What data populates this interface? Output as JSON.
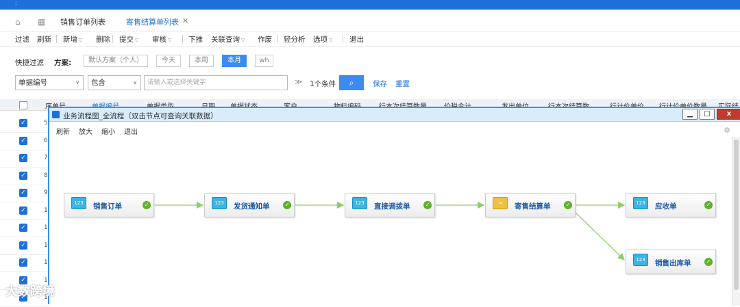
{
  "tabs": [
    {
      "label": "销售订单列表"
    },
    {
      "label": "寄售结算单列表",
      "close": "✕"
    }
  ],
  "toolbar": {
    "items": [
      "过滤",
      "刷新",
      "新增",
      "删除",
      "提交",
      "审核",
      "下推",
      "关联查询",
      "作废",
      "轻分析",
      "选项",
      "退出"
    ]
  },
  "quick_filter": {
    "label": "快捷过滤",
    "scheme_label": "方案:",
    "schemes": [
      "默认方案（个人）",
      "今天",
      "本周",
      "本月",
      "wh"
    ],
    "active_scheme": "本月"
  },
  "search": {
    "field": "单据编号",
    "operator": "包含",
    "placeholder": "请输入或选择关键字",
    "condition_count": "1个条件",
    "save": "保存",
    "reset": "重置"
  },
  "grid": {
    "headers": [
      "全选",
      "序单号",
      "单据编号",
      "单据类型",
      "日期",
      "单据状态",
      "客户",
      "物料编码",
      "行本次结算数量",
      "价税合计",
      "发出单位",
      "行本次结算数",
      "行计价单价",
      "行计价单价数量",
      "实际结"
    ],
    "row_nums": [
      "5",
      "6",
      "7",
      "8",
      "9",
      "1",
      "1",
      "1",
      "1",
      "1",
      "1"
    ]
  },
  "dialog": {
    "title": "业务流程图_全流程（双击节点可查询关联数据）",
    "menu": [
      "刷新",
      "放大",
      "缩小",
      "退出"
    ],
    "window_buttons": [
      "▁",
      "□",
      "x"
    ],
    "nodes": [
      {
        "label": "销售订单",
        "icon": "123"
      },
      {
        "label": "发货通知单",
        "icon": "123"
      },
      {
        "label": "直接调拨单",
        "icon": "123"
      },
      {
        "label": "寄售结算单",
        "icon": "document-arrow-icon"
      },
      {
        "label": "应收单",
        "icon": "123"
      },
      {
        "label": "销售出库单",
        "icon": "123"
      }
    ]
  },
  "watermark": "大数跨境",
  "colors": {
    "accent": "#1e6fd9",
    "ok_green": "#5fb32a",
    "node_icon": "#3cb4e5",
    "close_red": "#c23a2b"
  }
}
